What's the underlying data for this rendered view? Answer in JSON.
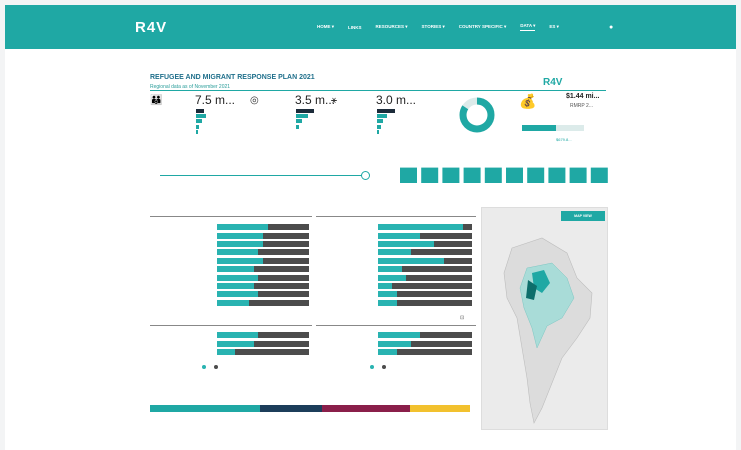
{
  "navbar": {
    "logo": "R4V",
    "items": [
      "HOME ▾",
      "LINKS",
      "RESOURCES ▾",
      "STORIES ▾",
      "COUNTRY SPECIFIC ▾",
      "DATA ▾",
      "ES ▾"
    ],
    "active_index": 5,
    "search_icon": "search-icon"
  },
  "report": {
    "title": "REFUGEE AND MIGRANT RESPONSE PLAN 2021",
    "subtitle": "Regional data as of November 2021",
    "logo": "R4V"
  },
  "kpis": [
    {
      "icon": "people-icon",
      "value": "7.5 m..."
    },
    {
      "icon": "target-icon",
      "value": "3.5 m..."
    },
    {
      "icon": "reach-icon",
      "value": "3.0 m..."
    }
  ],
  "funding": {
    "value": "$1.44 mi...",
    "sub": "RMRP 2...",
    "amount": "$679.8..."
  },
  "monthly": {
    "bar_levels": [
      0.7,
      0.7,
      0.7,
      0.7,
      0.7,
      0.7,
      0.7,
      0.7,
      0.7,
      0.7
    ]
  },
  "map": {
    "button": "MAP VIEW"
  },
  "colors": {
    "teal": "#1fa8a4",
    "dark": "#1c2b3a",
    "grey_bar": "#4c4c4c",
    "maroon": "#8a1f4a",
    "yellow": "#f2c12e"
  }
}
